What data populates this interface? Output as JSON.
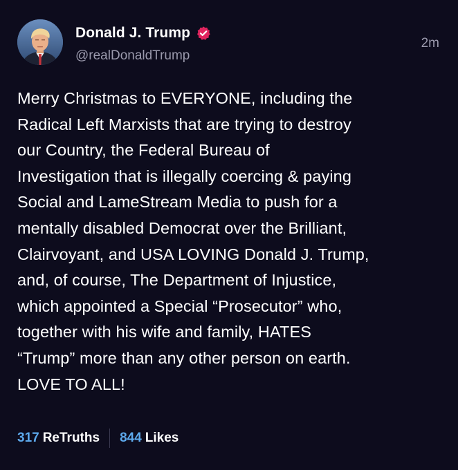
{
  "post": {
    "author": {
      "display_name": "Donald J. Trump",
      "handle": "@realDonaldTrump",
      "verified": true
    },
    "timestamp": "2m",
    "text": "Merry Christmas to EVERYONE, including the\nRadical Left Marxists that are trying to destroy\nour Country, the Federal Bureau of\nInvestigation that is illegally coercing & paying\nSocial and LameStream Media to push for a\nmentally disabled Democrat over the Brilliant,\nClairvoyant, and USA LOVING Donald J. Trump,\nand, of course, The Department of Injustice,\nwhich appointed a Special “Prosecutor” who,\ntogether with his wife and family, HATES\n“Trump” more than any other person on earth.\nLOVE TO ALL!",
    "stats": {
      "retruths_count": "317",
      "retruths_label": "ReTruths",
      "likes_count": "844",
      "likes_label": "Likes"
    }
  },
  "colors": {
    "background": "#0d0c1d",
    "muted_text": "#9b9aad",
    "stat_accent": "#5da9ec",
    "verified_badge": "#e0245e"
  },
  "icons": {
    "verified": "verified-badge-icon",
    "avatar": "profile-avatar"
  }
}
